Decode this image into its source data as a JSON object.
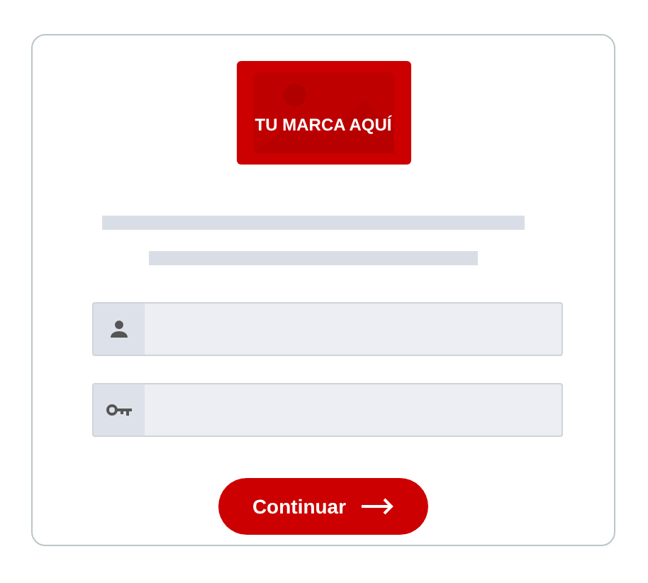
{
  "logo": {
    "text": "TU MARCA AQUÍ"
  },
  "fields": [
    {
      "kind": "user"
    },
    {
      "kind": "password"
    }
  ],
  "button": {
    "label": "Continuar"
  }
}
